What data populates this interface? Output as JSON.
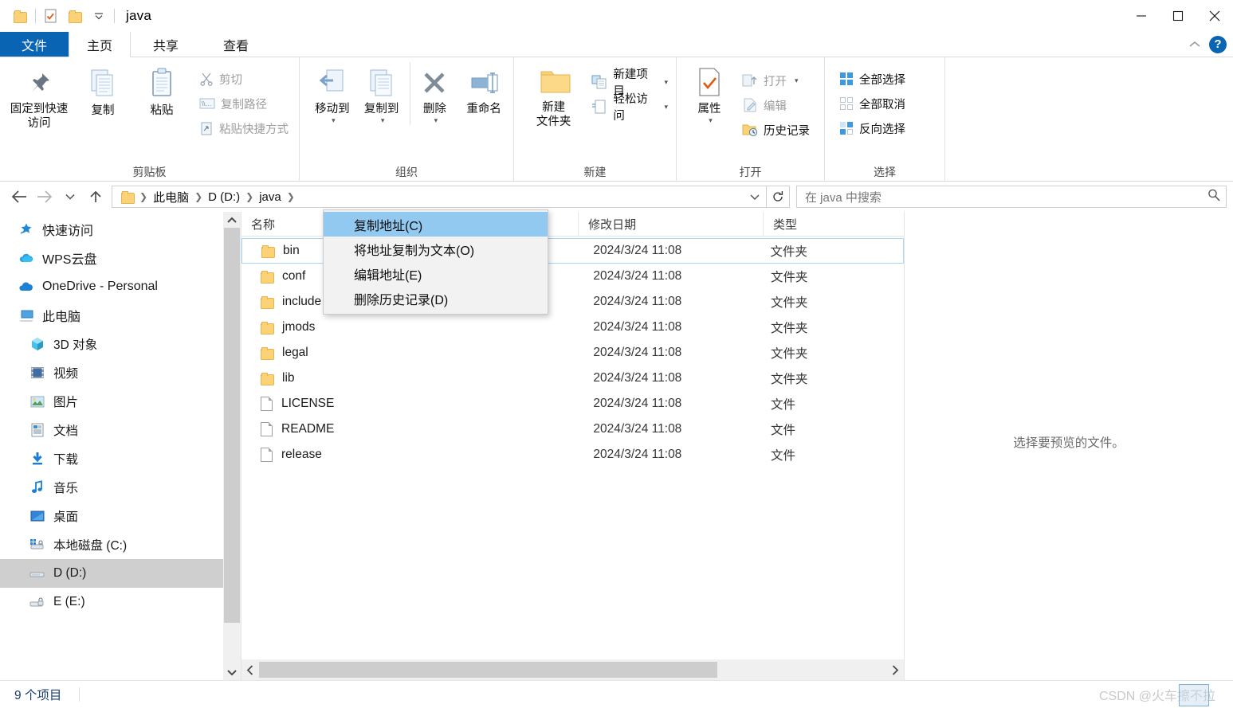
{
  "window": {
    "title": "java",
    "quick_access": [
      "folder-icon",
      "properties-icon",
      "new-folder-icon",
      "customize-dropdown"
    ],
    "controls": {
      "minimize": "—",
      "maximize": "□",
      "close": "✕"
    }
  },
  "ribbon": {
    "tabs": [
      {
        "label": "文件",
        "state": "file"
      },
      {
        "label": "主页",
        "state": "active"
      },
      {
        "label": "共享",
        "state": "normal"
      },
      {
        "label": "查看",
        "state": "normal"
      }
    ],
    "collapse_icon": "chevron-up-icon",
    "help_label": "?",
    "groups": [
      {
        "name": "clipboard",
        "label": "剪贴板",
        "big": [
          {
            "label": "固定到快速访问",
            "icon": "pin-icon"
          },
          {
            "label": "复制",
            "icon": "copy-icon"
          },
          {
            "label": "粘贴",
            "icon": "paste-icon"
          }
        ],
        "small": [
          {
            "label": "剪切",
            "icon": "scissors-icon",
            "dim": true
          },
          {
            "label": "复制路径",
            "icon": "copy-path-icon",
            "dim": true
          },
          {
            "label": "粘贴快捷方式",
            "icon": "paste-shortcut-icon",
            "dim": true
          }
        ]
      },
      {
        "name": "organize",
        "label": "组织",
        "big": [
          {
            "label": "移动到",
            "icon": "move-to-icon",
            "caret": true
          },
          {
            "label": "复制到",
            "icon": "copy-to-icon",
            "caret": true
          },
          {
            "label": "删除",
            "icon": "delete-x-icon",
            "caret": true
          },
          {
            "label": "重命名",
            "icon": "rename-icon"
          }
        ]
      },
      {
        "name": "new",
        "label": "新建",
        "big": [
          {
            "label": "新建\n文件夹",
            "icon": "new-folder-icon"
          }
        ],
        "small": [
          {
            "label": "新建项目",
            "icon": "new-item-icon",
            "caret": true
          },
          {
            "label": "轻松访问",
            "icon": "easy-access-icon",
            "caret": true
          }
        ]
      },
      {
        "name": "open",
        "label": "打开",
        "big": [
          {
            "label": "属性",
            "icon": "properties-icon",
            "caret": true
          }
        ],
        "small": [
          {
            "label": "打开",
            "icon": "open-icon",
            "dim": true,
            "caret": true
          },
          {
            "label": "编辑",
            "icon": "edit-icon",
            "dim": true
          },
          {
            "label": "历史记录",
            "icon": "history-icon"
          }
        ]
      },
      {
        "name": "select",
        "label": "选择",
        "small": [
          {
            "label": "全部选择",
            "icon": "select-all-icon"
          },
          {
            "label": "全部取消",
            "icon": "select-none-icon"
          },
          {
            "label": "反向选择",
            "icon": "invert-selection-icon"
          }
        ]
      }
    ]
  },
  "address": {
    "back_icon": "arrow-left-icon",
    "forward_icon": "arrow-right-icon",
    "recent_icon": "chevron-down-icon",
    "up_icon": "arrow-up-icon",
    "crumbs": [
      "此电脑",
      "D (D:)",
      "java"
    ],
    "dropdown_icon": "chevron-down-icon",
    "refresh_icon": "refresh-icon"
  },
  "search": {
    "placeholder": "在 java 中搜索",
    "icon": "search-icon"
  },
  "context_menu": {
    "items": [
      {
        "label": "复制地址(C)",
        "highlighted": true
      },
      {
        "label": "将地址复制为文本(O)",
        "highlighted": false
      },
      {
        "label": "编辑地址(E)",
        "highlighted": false
      },
      {
        "label": "删除历史记录(D)",
        "highlighted": false
      }
    ]
  },
  "sidebar": {
    "items": [
      {
        "label": "快速访问",
        "icon": "star-pin-icon",
        "level": 0,
        "selected": false
      },
      {
        "label": "WPS云盘",
        "icon": "wps-cloud-icon",
        "level": 0,
        "selected": false
      },
      {
        "label": "OneDrive - Personal",
        "icon": "onedrive-cloud-icon",
        "level": 0,
        "selected": false
      },
      {
        "label": "此电脑",
        "icon": "this-pc-icon",
        "level": 0,
        "selected": false
      },
      {
        "label": "3D 对象",
        "icon": "3d-objects-icon",
        "level": 1,
        "selected": false
      },
      {
        "label": "视频",
        "icon": "videos-icon",
        "level": 1,
        "selected": false
      },
      {
        "label": "图片",
        "icon": "pictures-icon",
        "level": 1,
        "selected": false
      },
      {
        "label": "文档",
        "icon": "documents-icon",
        "level": 1,
        "selected": false
      },
      {
        "label": "下载",
        "icon": "downloads-icon",
        "level": 1,
        "selected": false
      },
      {
        "label": "音乐",
        "icon": "music-icon",
        "level": 1,
        "selected": false
      },
      {
        "label": "桌面",
        "icon": "desktop-icon",
        "level": 1,
        "selected": false
      },
      {
        "label": "本地磁盘 (C:)",
        "icon": "system-drive-icon",
        "level": 1,
        "selected": false
      },
      {
        "label": "D (D:)",
        "icon": "drive-icon",
        "level": 1,
        "selected": true
      },
      {
        "label": "E (E:)",
        "icon": "locked-drive-icon",
        "level": 1,
        "selected": false
      }
    ],
    "scroll_up_icon": "chevron-up-icon",
    "scroll_down_icon": "chevron-down-icon"
  },
  "filelist": {
    "columns": [
      "名称",
      "修改日期",
      "类型"
    ],
    "rows": [
      {
        "name": "bin",
        "date": "2024/3/24 11:08",
        "type": "文件夹",
        "icon": "folder-icon",
        "selected": true
      },
      {
        "name": "conf",
        "date": "2024/3/24 11:08",
        "type": "文件夹",
        "icon": "folder-icon",
        "selected": false
      },
      {
        "name": "include",
        "date": "2024/3/24 11:08",
        "type": "文件夹",
        "icon": "folder-icon",
        "selected": false
      },
      {
        "name": "jmods",
        "date": "2024/3/24 11:08",
        "type": "文件夹",
        "icon": "folder-icon",
        "selected": false
      },
      {
        "name": "legal",
        "date": "2024/3/24 11:08",
        "type": "文件夹",
        "icon": "folder-icon",
        "selected": false
      },
      {
        "name": "lib",
        "date": "2024/3/24 11:08",
        "type": "文件夹",
        "icon": "folder-icon",
        "selected": false
      },
      {
        "name": "LICENSE",
        "date": "2024/3/24 11:08",
        "type": "文件",
        "icon": "file-icon",
        "selected": false
      },
      {
        "name": "README",
        "date": "2024/3/24 11:08",
        "type": "文件",
        "icon": "file-icon",
        "selected": false
      },
      {
        "name": "release",
        "date": "2024/3/24 11:08",
        "type": "文件",
        "icon": "file-icon",
        "selected": false
      }
    ],
    "hscroll_left_icon": "chevron-left-icon",
    "hscroll_right_icon": "chevron-right-icon"
  },
  "preview": {
    "message": "选择要预览的文件。"
  },
  "status": {
    "count": "9 个项目",
    "watermark": "CSDN @火车擦不拉"
  }
}
